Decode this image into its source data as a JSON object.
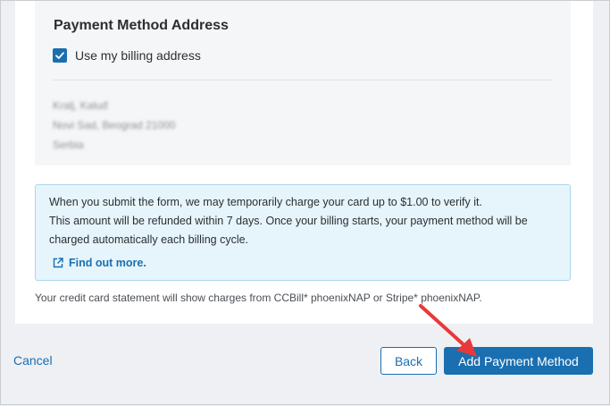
{
  "payment_address": {
    "title": "Payment Method Address",
    "use_billing_label": "Use my billing address",
    "use_billing_checked": true,
    "address_lines": [
      "Kralj, Kaluđ",
      "Novi Sad, Beograd 21000",
      "Serbia"
    ]
  },
  "info": {
    "line1": "When you submit the form, we may temporarily charge your card up to $1.00 to verify it.",
    "line2": "This amount will be refunded within 7 days. Once your billing starts, your payment method will be",
    "line3": "charged automatically each billing cycle.",
    "link_label": "Find out more."
  },
  "statement_text": "Your credit card statement will show charges from CCBill* phoenixNAP or Stripe* phoenixNAP.",
  "footer": {
    "cancel_label": "Cancel",
    "back_label": "Back",
    "add_label": "Add Payment Method"
  },
  "icons": {
    "checkbox": "check-icon",
    "link": "external-link-icon",
    "annotation": "red-arrow"
  },
  "colors": {
    "accent": "#1a6fb0",
    "info_background": "#e6f5fb",
    "info_border": "#a9d7ec",
    "annotation": "#e8393a"
  }
}
